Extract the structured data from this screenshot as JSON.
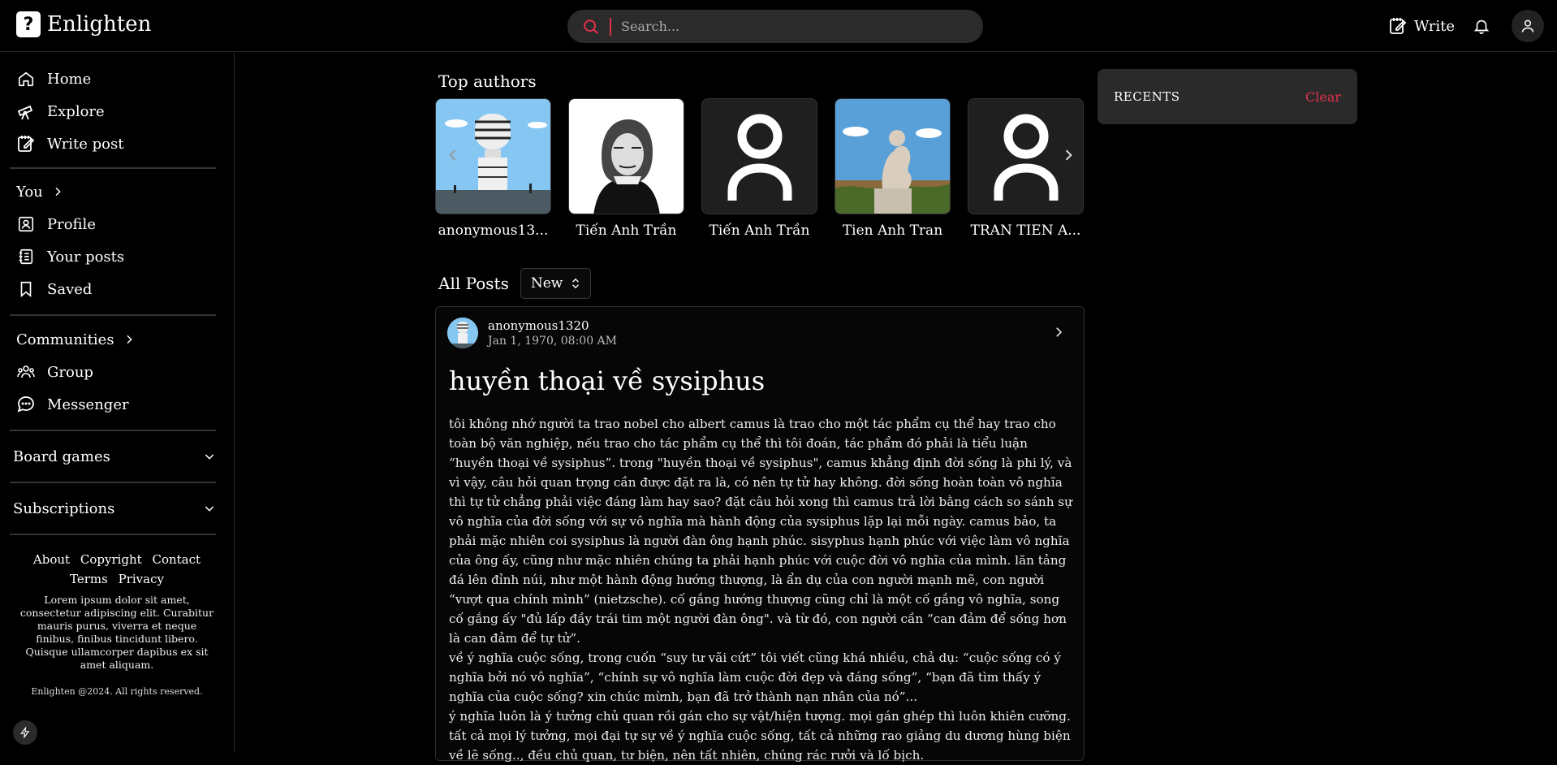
{
  "app": {
    "name": "Enlighten"
  },
  "search": {
    "placeholder": "Search..."
  },
  "header": {
    "write_label": "Write"
  },
  "sidebar": {
    "main_items": [
      {
        "label": "Home",
        "icon": "home-icon"
      },
      {
        "label": "Explore",
        "icon": "telescope-icon"
      },
      {
        "label": "Write post",
        "icon": "write-icon"
      }
    ],
    "you": {
      "label": "You",
      "items": [
        {
          "label": "Profile",
          "icon": "profile-icon"
        },
        {
          "label": "Your posts",
          "icon": "notebook-icon"
        },
        {
          "label": "Saved",
          "icon": "bookmark-icon"
        }
      ]
    },
    "communities": {
      "label": "Communities",
      "items": [
        {
          "label": "Group",
          "icon": "group-icon"
        },
        {
          "label": "Messenger",
          "icon": "chat-icon"
        }
      ]
    },
    "board_games": "Board games",
    "subscriptions": "Subscriptions",
    "footer": {
      "links": [
        "About",
        "Copyright",
        "Contact",
        "Terms",
        "Privacy"
      ],
      "lorem": "Lorem ipsum dolor sit amet, consectetur adipiscing elit. Curabitur mauris purus, viverra et neque finibus, finibus tincidunt libero. Quisque ullamcorper dapibus ex sit amet aliquam.",
      "copyright": "Enlighten @2024. All rights reserved."
    }
  },
  "top_authors": {
    "title": "Top authors",
    "authors": [
      {
        "name": "anonymous13...",
        "pic": "statue-sky"
      },
      {
        "name": "Tiến Anh Trần",
        "pic": "portrait-engraving"
      },
      {
        "name": "Tiến Anh Trần",
        "pic": "default-avatar"
      },
      {
        "name": "Tien Anh Tran",
        "pic": "thinker-statue"
      },
      {
        "name": "TRAN TIEN A...",
        "pic": "default-avatar"
      }
    ]
  },
  "posts": {
    "title": "All Posts",
    "sort_value": "New",
    "items": [
      {
        "author": "anonymous1320",
        "date": "Jan 1, 1970, 08:00 AM",
        "title": "huyền thoại về sysiphus",
        "paragraphs": [
          "tôi không nhớ người ta trao nobel cho albert camus là trao cho một tác phẩm cụ thể hay trao cho toàn bộ văn nghiệp, nếu trao cho tác phẩm cụ thể thì tôi đoán, tác phẩm đó phải là tiểu luận “huyền thoại về sysiphus”. trong \"huyền thoại về sysiphus\", camus khẳng định đời sống là phi lý, và vì vậy, câu hỏi quan trọng cần được đặt ra là, có nên tự tử hay không. đời sống hoàn toàn vô nghĩa thì tự tử chẳng phải việc đáng làm hay sao? đặt câu hỏi xong thì camus trả lời bằng cách so sánh sự vô nghĩa của đời sống với sự vô nghĩa mà hành động của sysiphus lặp lại mỗi ngày. camus bảo, ta phải mặc nhiên coi sysiphus là người đàn ông hạnh phúc. sisyphus hạnh phúc với việc làm vô nghĩa của ông ấy, cũng như mặc nhiên chúng ta phải hạnh phúc với cuộc đời vô nghĩa của mình. lăn tảng đá lên đỉnh núi, như một hành động hướng thượng, là ẩn dụ của con người mạnh mẽ, con người “vượt qua chính mình” (nietzsche). cố gắng hướng thượng cũng chỉ là một cố gắng vô nghĩa, song cố gắng ấy \"đủ lấp đầy trái tim một người đàn ông\". và từ đó, con người cần “can đảm để sống hơn là can đảm để tự tử”.",
          "về ý nghĩa cuộc sống, trong cuốn “suy tư vãi cứt” tôi viết cũng khá nhiều, chả dụ: “cuộc sống có ý nghĩa bởi nó vô nghĩa”, “chính sự vô nghĩa làm cuộc đời đẹp và đáng sống”, “bạn đã tìm thấy ý nghĩa của cuộc sống? xin chúc mừnh, bạn đã trở thành nạn nhân của nó”...",
          "ý nghĩa luôn là ý tưởng chủ quan rồi gán cho sự vật/hiện tượng. mọi gán ghép thì luôn khiên cưỡng. tất cả mọi lý tưởng, mọi đại tự sự về ý nghĩa cuộc sống, tất cả những rao giảng du dương hùng biện về lẽ sống.., đều chủ quan, tư biện, nên tất nhiên, chúng rác rưởi và lố bịch."
        ]
      }
    ]
  },
  "recents": {
    "label": "RECENTS",
    "clear_label": "Clear"
  }
}
